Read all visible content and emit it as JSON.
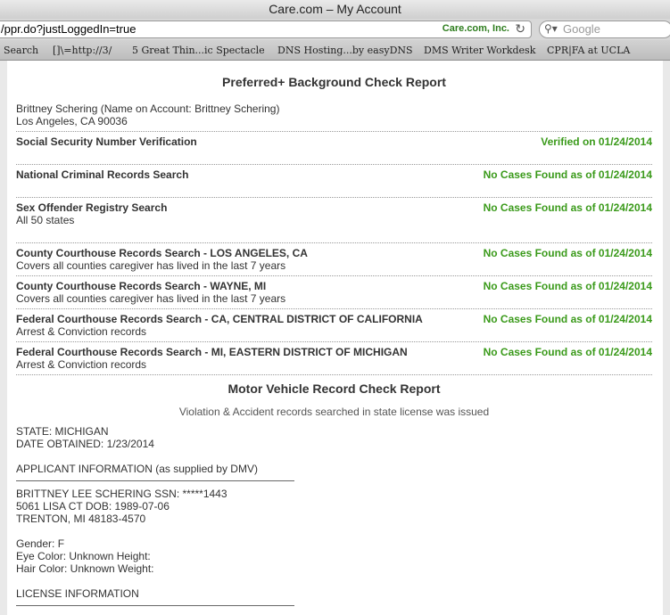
{
  "window": {
    "title": "Care.com – My Account"
  },
  "toolbar": {
    "url": "/ppr.do?justLoggedIn=true",
    "cert_name": "Care.com, Inc.",
    "reload_icon": "reload-icon",
    "search_placeholder": "Google"
  },
  "bookmarks": [
    "Search",
    "[]\\=http://3/",
    "5 Great Thin...ic Spectacle",
    "DNS Hosting...by easyDNS",
    "DMS Writer Workdesk",
    "CPR|FA at UCLA"
  ],
  "report": {
    "title": "Preferred+ Background Check Report",
    "name_line": "Brittney Schering  (Name on Account: Brittney Schering)",
    "location": "Los Angeles,  CA  90036",
    "items": [
      {
        "title": "Social Security Number Verification",
        "subtitle": "",
        "status": "Verified on 01/24/2014"
      },
      {
        "title": "National Criminal Records Search",
        "subtitle": "",
        "status": "No Cases Found as of 01/24/2014"
      },
      {
        "title": "Sex Offender Registry Search",
        "subtitle": "All 50 states",
        "status": "No Cases Found as of 01/24/2014"
      },
      {
        "title": "County Courthouse Records Search - LOS ANGELES, CA",
        "subtitle": "Covers all counties caregiver has lived in the last 7 years",
        "status": "No Cases Found as of 01/24/2014"
      },
      {
        "title": "County Courthouse Records Search - WAYNE, MI",
        "subtitle": "Covers all counties caregiver has lived in the last 7 years",
        "status": "No Cases Found as of 01/24/2014"
      },
      {
        "title": "Federal Courthouse Records Search - CA, CENTRAL DISTRICT OF CALIFORNIA",
        "subtitle": "Arrest & Conviction records",
        "status": "No Cases Found as of 01/24/2014"
      },
      {
        "title": "Federal Courthouse Records Search - MI, EASTERN DISTRICT OF MICHIGAN",
        "subtitle": "Arrest & Conviction records",
        "status": "No Cases Found as of 01/24/2014"
      }
    ]
  },
  "mvr": {
    "title": "Motor Vehicle Record Check Report",
    "note": "Violation & Accident records searched in state license was issued",
    "state": "STATE: MICHIGAN",
    "date": "DATE OBTAINED: 1/23/2014",
    "applicant_header": "APPLICANT INFORMATION (as supplied by DMV)",
    "line1": "BRITTNEY LEE SCHERING SSN: *****1443",
    "line2": "5061 LISA CT DOB: 1989-07-06",
    "line3": "TRENTON, MI 48183-4570",
    "gender": "Gender: F",
    "eye": "Eye Color: Unknown Height:",
    "hair": "Hair Color: Unknown Weight:",
    "license_header": "LICENSE INFORMATION"
  }
}
